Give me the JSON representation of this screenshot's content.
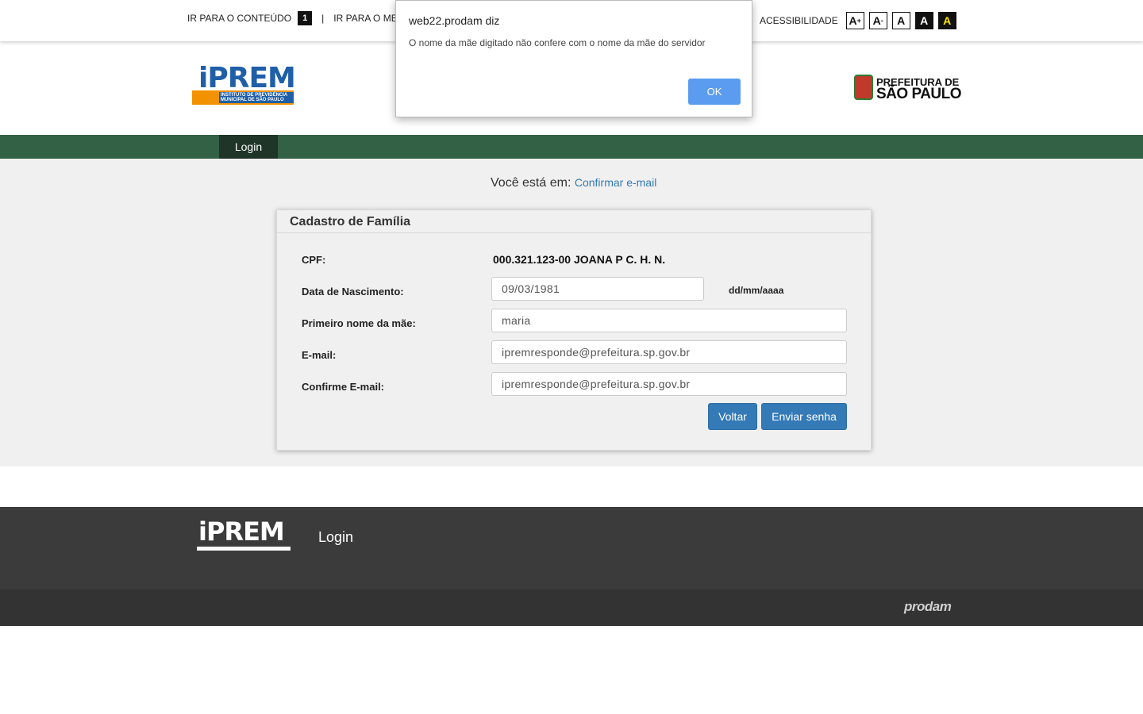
{
  "topbar": {
    "skip_content": "IR PARA O CONTEÚDO",
    "skip_content_key": "1",
    "separator": "|",
    "skip_menu": "IR PARA O ME",
    "accessibility_label": "ACESSIBILIDADE",
    "font_increase": "A",
    "font_increase_sup": "+",
    "font_decrease": "A",
    "font_decrease_sup": "-",
    "font_normal": "A",
    "contrast_dark": "A",
    "contrast_yellow": "A"
  },
  "header": {
    "iprem_word": "iPREM",
    "iprem_subtitle": "INSTITUTO DE PREVIDÊNCIA MUNICIPAL DE SÃO PAULO",
    "pref_line1": "PREFEITURA DE",
    "pref_line2": "SÃO PAULO"
  },
  "nav": {
    "login": "Login"
  },
  "breadcrumb": {
    "prefix": "Você está em:",
    "current": "Confirmar e-mail"
  },
  "form": {
    "title": "Cadastro de Família",
    "cpf_label": "CPF:",
    "cpf_value": "000.321.123-00 JOANA P C. H. N.",
    "birth_label": "Data de Nascimento:",
    "birth_value": "09/03/1981",
    "birth_hint": "dd/mm/aaaa",
    "mother_label": "Primeiro nome da mãe:",
    "mother_value": "maria",
    "email_label": "E-mail:",
    "email_value": "ipremresponde@prefeitura.sp.gov.br",
    "email_confirm_label": "Confirme E-mail:",
    "email_confirm_value": "ipremresponde@prefeitura.sp.gov.br",
    "back_button": "Voltar",
    "submit_button": "Enviar senha"
  },
  "footer": {
    "logo_word": "iPREM",
    "login_link": "Login",
    "prodam": "prodam"
  },
  "dialog": {
    "title": "web22.prodam diz",
    "message": "O nome da mãe digitado não confere com o nome da mãe do servidor",
    "ok": "OK"
  }
}
